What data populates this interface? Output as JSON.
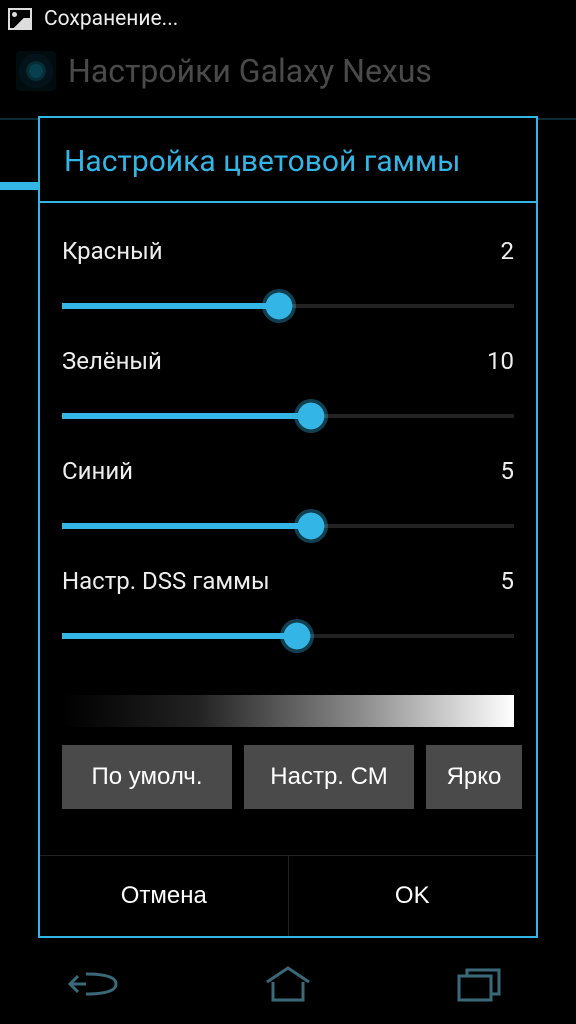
{
  "status": {
    "text": "Сохранение..."
  },
  "app": {
    "title": "Настройки Galaxy Nexus"
  },
  "dialog": {
    "title": "Настройка цветовой гаммы",
    "sliders": [
      {
        "label": "Красный",
        "value": 2,
        "pct": 48
      },
      {
        "label": "Зелёный",
        "value": 10,
        "pct": 55
      },
      {
        "label": "Синий",
        "value": 5,
        "pct": 55
      },
      {
        "label": "Настр. DSS гаммы",
        "value": 5,
        "pct": 52
      }
    ],
    "presets": [
      {
        "label": "По умолч."
      },
      {
        "label": "Настр. СМ"
      },
      {
        "label": "Ярко"
      }
    ],
    "footer": {
      "cancel": "Отмена",
      "ok": "OK"
    }
  }
}
